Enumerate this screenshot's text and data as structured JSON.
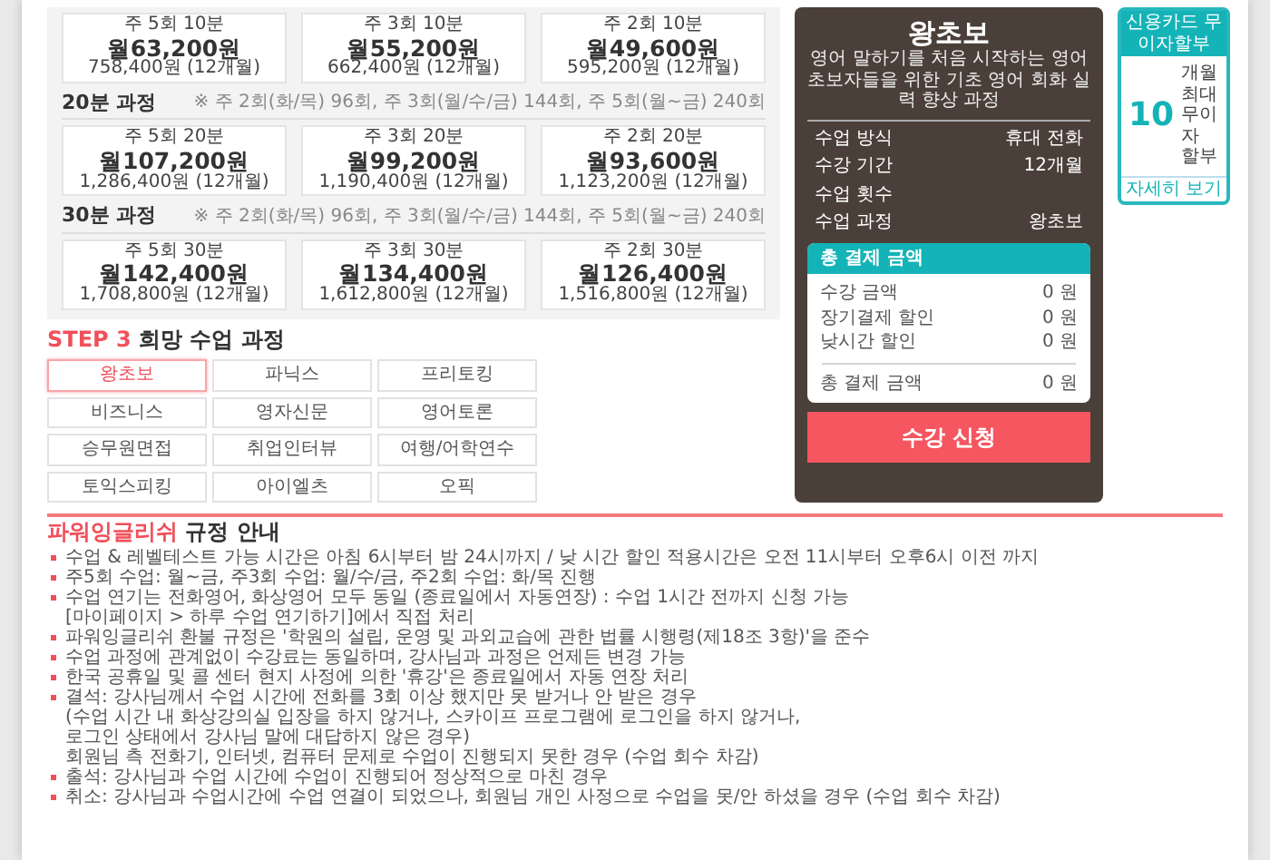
{
  "pricing": {
    "groups": [
      {
        "cards": [
          {
            "plan": "주 5회 10분",
            "price": "월63,200원",
            "total": "758,400원 (12개월)"
          },
          {
            "plan": "주 3회 10분",
            "price": "월55,200원",
            "total": "662,400원 (12개월)"
          },
          {
            "plan": "주 2회 10분",
            "price": "월49,600원",
            "total": "595,200원 (12개월)"
          }
        ]
      },
      {
        "title": "20분 과정",
        "note": "※ 주 2회(화/목) 96회, 주 3회(월/수/금) 144회, 주 5회(월~금) 240회",
        "cards": [
          {
            "plan": "주 5회 20분",
            "price": "월107,200원",
            "total": "1,286,400원 (12개월)"
          },
          {
            "plan": "주 3회 20분",
            "price": "월99,200원",
            "total": "1,190,400원 (12개월)"
          },
          {
            "plan": "주 2회 20분",
            "price": "월93,600원",
            "total": "1,123,200원 (12개월)"
          }
        ]
      },
      {
        "title": "30분 과정",
        "note": "※ 주 2회(화/목) 96회, 주 3회(월/수/금) 144회, 주 5회(월~금) 240회",
        "cards": [
          {
            "plan": "주 5회 30분",
            "price": "월142,400원",
            "total": "1,708,800원 (12개월)"
          },
          {
            "plan": "주 3회 30분",
            "price": "월134,400원",
            "total": "1,612,800원 (12개월)"
          },
          {
            "plan": "주 2회 30분",
            "price": "월126,400원",
            "total": "1,516,800원 (12개월)"
          }
        ]
      }
    ]
  },
  "step": {
    "label": "STEP 3",
    "title": "희망 수업 과정",
    "options": [
      {
        "label": "왕초보",
        "selected": true
      },
      {
        "label": "파닉스",
        "selected": false
      },
      {
        "label": "프리토킹",
        "selected": false
      },
      {
        "label": "비즈니스",
        "selected": false
      },
      {
        "label": "영자신문",
        "selected": false
      },
      {
        "label": "영어토론",
        "selected": false
      },
      {
        "label": "승무원면접",
        "selected": false
      },
      {
        "label": "취업인터뷰",
        "selected": false
      },
      {
        "label": "여행/어학연수",
        "selected": false
      },
      {
        "label": "토익스피킹",
        "selected": false
      },
      {
        "label": "아이엘츠",
        "selected": false
      },
      {
        "label": "오픽",
        "selected": false
      }
    ]
  },
  "summary": {
    "title": "왕초보",
    "description": "영어 말하기를 처음 시작하는 영어 초보자들을 위한 기초 영어 회화 실력 향상 과정",
    "rows": [
      {
        "label": "수업 방식",
        "value": "휴대 전화"
      },
      {
        "label": "수강 기간",
        "value": "12개월"
      },
      {
        "label": "수업 횟수"
      },
      {
        "label": "수업 과정",
        "value": "왕초보"
      }
    ],
    "payment": {
      "title": "총 결제 금액",
      "rows": [
        {
          "label": "수강 금액",
          "value": "0 원"
        },
        {
          "label": "장기결제 할인",
          "value": "0 원"
        },
        {
          "label": "낮시간 할인",
          "value": "0 원"
        }
      ],
      "total_label": "총 결제 금액",
      "total_value": "0 원"
    },
    "button": "수강 신청"
  },
  "promo": {
    "header": "신용카드 무이자할부",
    "number": "10",
    "text": "개월 최대 무이자 할부",
    "link": "자세히 보기"
  },
  "rules": {
    "brand": "파워잉글리쉬",
    "title": "규정 안내",
    "items": [
      {
        "lines": [
          "수업 & 레벨테스트 가능 시간은 아침 6시부터 밤 24시까지 / 낮 시간 할인 적용시간은 오전 11시부터 오후6시 이전 까지"
        ]
      },
      {
        "lines": [
          "주5회 수업: 월~금, 주3회 수업: 월/수/금, 주2회 수업: 화/목 진행"
        ]
      },
      {
        "lines": [
          "수업 연기는 전화영어, 화상영어 모두 동일 (종료일에서 자동연장) : 수업 1시간 전까지 신청 가능",
          "[마이페이지 > 하루 수업 연기하기]에서 직접 처리"
        ]
      },
      {
        "lines": [
          "파워잉글리쉬 환불 규정은 '학원의 설립, 운영 및 과외교습에 관한 법률 시행령(제18조 3항)'을 준수"
        ]
      },
      {
        "lines": [
          "수업 과정에 관계없이 수강료는 동일하며, 강사님과 과정은 언제든 변경 가능"
        ]
      },
      {
        "lines": [
          "한국 공휴일 및 콜 센터 현지 사정에 의한 '휴강'은 종료일에서 자동 연장 처리"
        ]
      },
      {
        "lines": [
          "결석: 강사님께서 수업 시간에 전화를 3회 이상 했지만 못 받거나 안 받은 경우",
          "(수업 시간 내 화상강의실 입장을 하지 않거나, 스카이프 프로그램에 로그인을 하지 않거나,",
          "로그인 상태에서 강사님 말에 대답하지 않은 경우)",
          "회원님 측 전화기, 인터넷, 컴퓨터 문제로 수업이 진행되지 못한 경우 (수업 회수 차감)"
        ]
      },
      {
        "lines": [
          "출석: 강사님과 수업 시간에 수업이 진행되어 정상적으로 마친 경우"
        ]
      },
      {
        "lines": [
          "취소: 강사님과 수업시간에 수업 연결이 되었으나, 회원님 개인 사정으로 수업을 못/안 하셨을 경우 (수업 회수 차감)"
        ]
      }
    ]
  }
}
